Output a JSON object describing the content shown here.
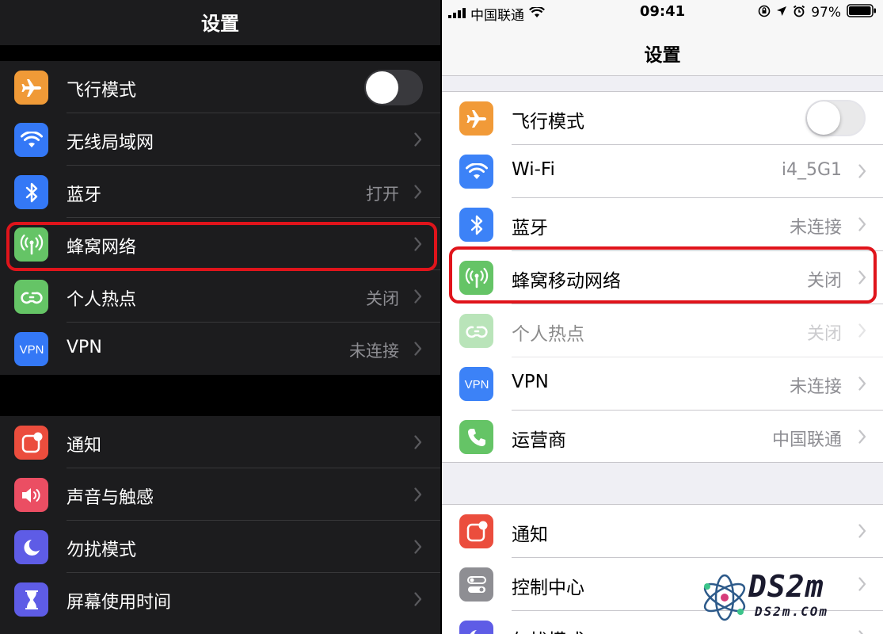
{
  "dark_panel": {
    "title": "设置",
    "group1": [
      {
        "label": "飞行模式",
        "icon": "airplane-icon",
        "color": "#f09a37",
        "toggle": false
      },
      {
        "label": "无线局域网",
        "icon": "wifi-icon",
        "color": "#3478f6",
        "value": ""
      },
      {
        "label": "蓝牙",
        "icon": "bluetooth-icon",
        "color": "#3478f6",
        "value": "打开"
      },
      {
        "label": "蜂窝网络",
        "icon": "cellular-icon",
        "color": "#65c466",
        "value": "",
        "highlighted": true
      },
      {
        "label": "个人热点",
        "icon": "hotspot-icon",
        "color": "#65c466",
        "value": "关闭"
      },
      {
        "label": "VPN",
        "icon": "vpn-icon",
        "color": "#3478f6",
        "value": "未连接"
      }
    ],
    "group2": [
      {
        "label": "通知",
        "icon": "notifications-icon",
        "color": "#eb4d3d",
        "value": ""
      },
      {
        "label": "声音与触感",
        "icon": "sound-icon",
        "color": "#eb4e63",
        "value": ""
      },
      {
        "label": "勿扰模式",
        "icon": "moon-icon",
        "color": "#5e5ce6",
        "value": ""
      },
      {
        "label": "屏幕使用时间",
        "icon": "hourglass-icon",
        "color": "#5e5ce6",
        "value": ""
      }
    ]
  },
  "light_panel": {
    "status_bar": {
      "carrier": "中国联通",
      "time": "09:41",
      "battery": "97%"
    },
    "title": "设置",
    "group1": [
      {
        "label": "飞行模式",
        "icon": "airplane-icon",
        "color": "#f19a38",
        "toggle": false
      },
      {
        "label": "Wi-Fi",
        "icon": "wifi-icon",
        "color": "#3c82f7",
        "value": "i4_5G1"
      },
      {
        "label": "蓝牙",
        "icon": "bluetooth-icon",
        "color": "#3c82f7",
        "value": "未连接"
      },
      {
        "label": "蜂窝移动网络",
        "icon": "cellular-icon",
        "color": "#65c466",
        "value": "关闭",
        "highlighted": true
      },
      {
        "label": "个人热点",
        "icon": "hotspot-icon",
        "color": "#65c466",
        "value": "关闭",
        "disabled": true
      },
      {
        "label": "VPN",
        "icon": "vpn-icon",
        "color": "#3c82f7",
        "value": "未连接"
      },
      {
        "label": "运营商",
        "icon": "phone-icon",
        "color": "#65c466",
        "value": "中国联通"
      }
    ],
    "group2": [
      {
        "label": "通知",
        "icon": "notifications-icon",
        "color": "#eb4d3d",
        "value": ""
      },
      {
        "label": "控制中心",
        "icon": "control-center-icon",
        "color": "#8e8e93",
        "value": ""
      },
      {
        "label": "勿扰模式",
        "icon": "moon-icon",
        "color": "#5e5ce6",
        "value": ""
      }
    ]
  },
  "watermark": {
    "logo_text": "DS2m",
    "url_text": "DS2m.COm"
  },
  "colors": {
    "highlight_border": "#e0141b"
  }
}
